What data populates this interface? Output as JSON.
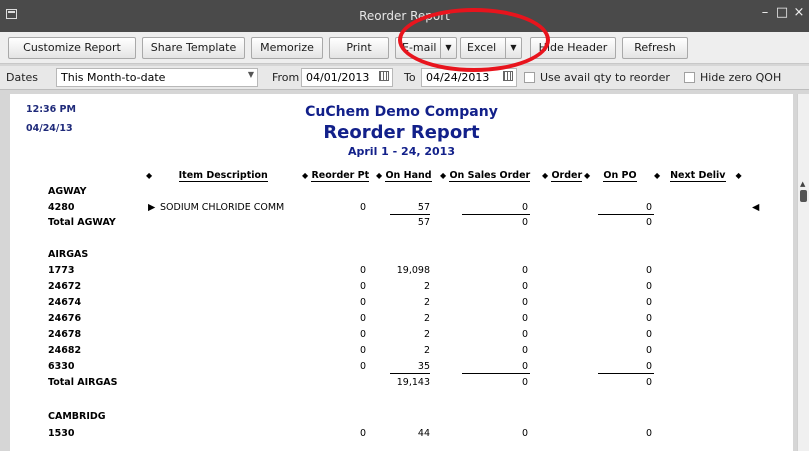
{
  "window": {
    "title": "Reorder Report"
  },
  "toolbar": {
    "customize": "Customize Report",
    "share": "Share Template",
    "memorize": "Memorize",
    "print": "Print",
    "email": "E-mail",
    "excel": "Excel",
    "hide_header": "Hide Header",
    "refresh": "Refresh"
  },
  "filters": {
    "dates_label": "Dates",
    "dates_value": "This Month-to-date",
    "from_label": "From",
    "from_value": "04/01/2013",
    "to_label": "To",
    "to_value": "04/24/2013",
    "use_avail_label": "Use avail qty to reorder",
    "hide_zero_label": "Hide zero QOH"
  },
  "report": {
    "time": "12:36 PM",
    "date": "04/24/13",
    "company": "CuChem Demo Company",
    "title": "Reorder Report",
    "period": "April 1 - 24, 2013",
    "columns": {
      "item_description": "Item Description",
      "reorder_pt": "Reorder Pt",
      "on_hand": "On Hand",
      "on_sales_order": "On Sales Order",
      "order": "Order",
      "on_po": "On PO",
      "next_deliv": "Next Deliv"
    },
    "groups": [
      {
        "name": "AGWAY",
        "rows": [
          {
            "item": "4280",
            "desc": "SODIUM CHLORIDE COMM",
            "reorder": "0",
            "onhand": "57",
            "onso": "0",
            "onpo": "0"
          }
        ],
        "total_label": "Total AGWAY",
        "total_onhand": "57",
        "total_onso": "0",
        "total_onpo": "0"
      },
      {
        "name": "AIRGAS",
        "rows": [
          {
            "item": "1773",
            "reorder": "0",
            "onhand": "19,098",
            "onso": "0",
            "onpo": "0"
          },
          {
            "item": "24672",
            "reorder": "0",
            "onhand": "2",
            "onso": "0",
            "onpo": "0"
          },
          {
            "item": "24674",
            "reorder": "0",
            "onhand": "2",
            "onso": "0",
            "onpo": "0"
          },
          {
            "item": "24676",
            "reorder": "0",
            "onhand": "2",
            "onso": "0",
            "onpo": "0"
          },
          {
            "item": "24678",
            "reorder": "0",
            "onhand": "2",
            "onso": "0",
            "onpo": "0"
          },
          {
            "item": "24682",
            "reorder": "0",
            "onhand": "2",
            "onso": "0",
            "onpo": "0"
          },
          {
            "item": "6330",
            "reorder": "0",
            "onhand": "35",
            "onso": "0",
            "onpo": "0"
          }
        ],
        "total_label": "Total AIRGAS",
        "total_onhand": "19,143",
        "total_onso": "0",
        "total_onpo": "0"
      },
      {
        "name": "CAMBRIDG",
        "rows": [
          {
            "item": "1530",
            "reorder": "0",
            "onhand": "44",
            "onso": "0",
            "onpo": "0"
          }
        ]
      }
    ]
  },
  "colors": {
    "annotation": "#e8141d",
    "header_text": "#12208a"
  }
}
